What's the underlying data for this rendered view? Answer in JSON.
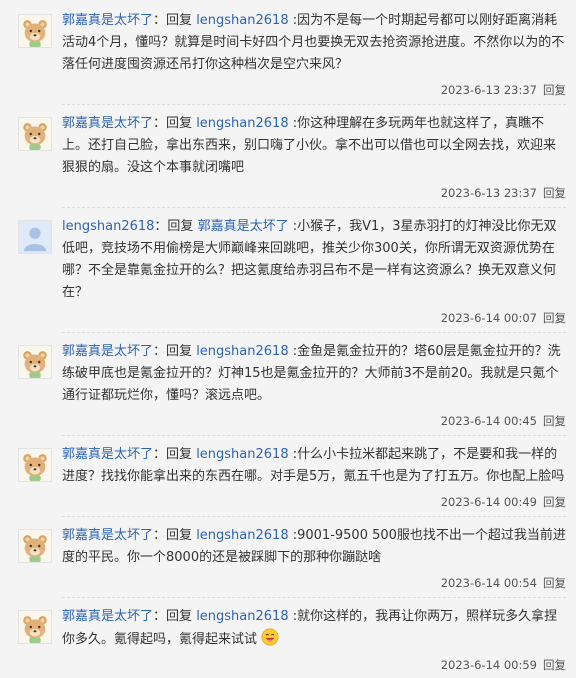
{
  "reply_word": "回复",
  "comments": [
    {
      "author": "郭嘉真是太坏了",
      "target": "lengshan2618",
      "text": ":因为不是每一个时期起号都可以刚好距离消耗活动4个月，懂吗？就算是时间卡好四个月也要换无双去抢资源抢进度。不然你以为的不落任何进度囤资源还吊打你这种档次是空穴来风？",
      "time": "2023-6-13 23:37",
      "avatar": "bear-avatar"
    },
    {
      "author": "郭嘉真是太坏了",
      "target": "lengshan2618",
      "text": ":你这种理解在多玩两年也就这样了，真瞧不上。还打自己脸，拿出东西来，别口嗨了小伙。拿不出可以借也可以全网去找，欢迎来狠狠的扇。没这个本事就闭嘴吧",
      "time": "2023-6-13 23:37",
      "avatar": "bear-avatar"
    },
    {
      "author": "lengshan2618",
      "target": "郭嘉真是太坏了",
      "text": ":小猴子，我V1，3星赤羽打的灯神没比你无双低吧，竞技场不用偷榜是大师巅峰来回跳吧，推关少你300关，你所谓无双资源优势在哪？不全是靠氪金拉开的么？把这氪度给赤羽吕布不是一样有这资源么？换无双意义何在？",
      "time": "2023-6-14 00:07",
      "avatar": "default-avatar"
    },
    {
      "author": "郭嘉真是太坏了",
      "target": "lengshan2618",
      "text": ":金鱼是氪金拉开的？塔60层是氪金拉开的？洗练破甲底也是氪金拉开的？灯神15也是氪金拉开的？大师前3不是前20。我就是只氪个通行证都玩烂你，懂吗？滚远点吧。",
      "time": "2023-6-14 00:45",
      "avatar": "bear-avatar"
    },
    {
      "author": "郭嘉真是太坏了",
      "target": "lengshan2618",
      "text": ":什么小卡拉米都起来跳了，不是要和我一样的进度？找找你能拿出来的东西在哪。对手是5万，氪五千也是为了打五万。你也配上脸吗",
      "time": "2023-6-14 00:49",
      "avatar": "bear-avatar"
    },
    {
      "author": "郭嘉真是太坏了",
      "target": "lengshan2618",
      "text": ":9001-9500 500服也找不出一个超过我当前进度的平民。你一个8000的还是被踩脚下的那种你蹦跶啥",
      "time": "2023-6-14 00:54",
      "avatar": "bear-avatar"
    },
    {
      "author": "郭嘉真是太坏了",
      "target": "lengshan2618",
      "text": ":就你这样的，我再让你两万，照样玩多久拿捏你多久。氪得起吗，氪得起来试试",
      "time": "2023-6-14 00:59",
      "avatar": "bear-avatar",
      "emoji": "grin-emoji"
    }
  ]
}
